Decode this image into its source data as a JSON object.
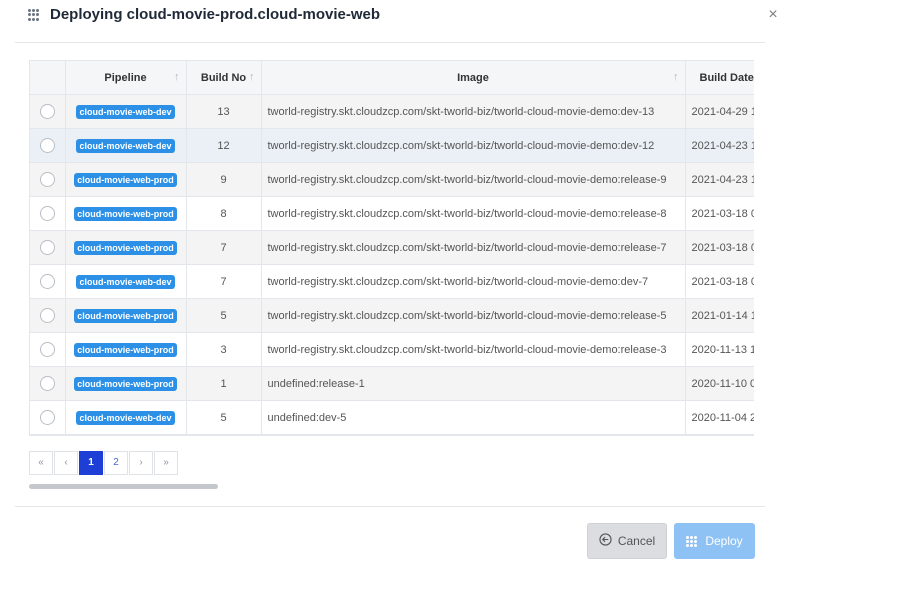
{
  "dialog": {
    "title": "Deploying cloud-movie-prod.cloud-movie-web",
    "close_label": "×"
  },
  "table": {
    "headers": {
      "pipeline": "Pipeline",
      "build_no": "Build No",
      "image": "Image",
      "build_date": "Build Date"
    },
    "sort_glyph": "↑",
    "rows": [
      {
        "pipeline": "cloud-movie-web-dev",
        "build_no": "13",
        "image": "tworld-registry.skt.cloudzcp.com/skt-tworld-biz/tworld-cloud-movie-demo:dev-13",
        "build_date": "2021-04-29 1"
      },
      {
        "pipeline": "cloud-movie-web-dev",
        "build_no": "12",
        "image": "tworld-registry.skt.cloudzcp.com/skt-tworld-biz/tworld-cloud-movie-demo:dev-12",
        "build_date": "2021-04-23 1"
      },
      {
        "pipeline": "cloud-movie-web-prod",
        "build_no": "9",
        "image": "tworld-registry.skt.cloudzcp.com/skt-tworld-biz/tworld-cloud-movie-demo:release-9",
        "build_date": "2021-04-23 1"
      },
      {
        "pipeline": "cloud-movie-web-prod",
        "build_no": "8",
        "image": "tworld-registry.skt.cloudzcp.com/skt-tworld-biz/tworld-cloud-movie-demo:release-8",
        "build_date": "2021-03-18 0"
      },
      {
        "pipeline": "cloud-movie-web-prod",
        "build_no": "7",
        "image": "tworld-registry.skt.cloudzcp.com/skt-tworld-biz/tworld-cloud-movie-demo:release-7",
        "build_date": "2021-03-18 0"
      },
      {
        "pipeline": "cloud-movie-web-dev",
        "build_no": "7",
        "image": "tworld-registry.skt.cloudzcp.com/skt-tworld-biz/tworld-cloud-movie-demo:dev-7",
        "build_date": "2021-03-18 0"
      },
      {
        "pipeline": "cloud-movie-web-prod",
        "build_no": "5",
        "image": "tworld-registry.skt.cloudzcp.com/skt-tworld-biz/tworld-cloud-movie-demo:release-5",
        "build_date": "2021-01-14 1"
      },
      {
        "pipeline": "cloud-movie-web-prod",
        "build_no": "3",
        "image": "tworld-registry.skt.cloudzcp.com/skt-tworld-biz/tworld-cloud-movie-demo:release-3",
        "build_date": "2020-11-13 1"
      },
      {
        "pipeline": "cloud-movie-web-prod",
        "build_no": "1",
        "image": "undefined:release-1",
        "build_date": "2020-11-10 0"
      },
      {
        "pipeline": "cloud-movie-web-dev",
        "build_no": "5",
        "image": "undefined:dev-5",
        "build_date": "2020-11-04 2"
      }
    ]
  },
  "pagination": {
    "first": "«",
    "prev": "‹",
    "pages": [
      "1",
      "2"
    ],
    "current": "1",
    "next": "›",
    "last": "»"
  },
  "footer": {
    "cancel_label": "Cancel",
    "deploy_label": "Deploy",
    "cancel_icon": "circle-arrow-left-icon",
    "deploy_icon": "grid-dots-icon"
  },
  "colors": {
    "badge": "#2b90e6",
    "active_page": "#1e3fd6",
    "deploy_button": "#8fc2f4"
  }
}
